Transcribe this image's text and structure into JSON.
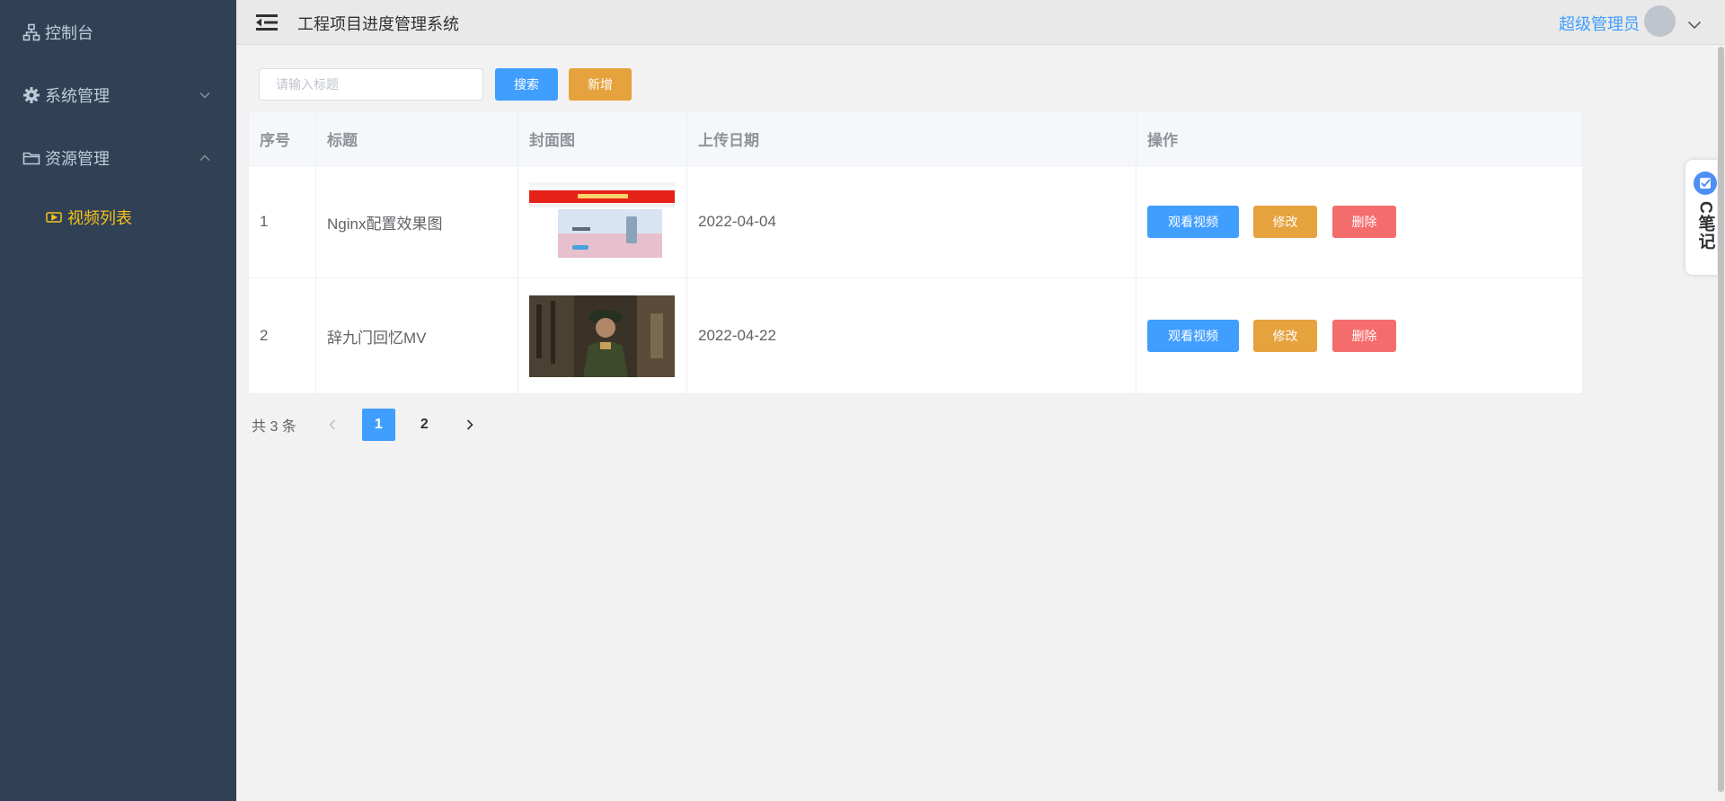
{
  "sidebar": {
    "items": [
      {
        "label": "控制台",
        "icon": "sitemap-icon"
      },
      {
        "label": "系统管理",
        "icon": "gear-icon",
        "expanded": false
      },
      {
        "label": "资源管理",
        "icon": "folder-icon",
        "expanded": true
      },
      {
        "label": "视频列表",
        "icon": "video-icon",
        "active": true
      }
    ],
    "active_color": "#f4c01a"
  },
  "header": {
    "title": "工程项目进度管理系统",
    "user_name": "超级管理员"
  },
  "toolbar": {
    "search_placeholder": "请输入标题",
    "search_value": "",
    "search_label": "搜索",
    "add_label": "新增"
  },
  "table": {
    "columns": [
      "序号",
      "标题",
      "封面图",
      "上传日期",
      "操作"
    ],
    "rows": [
      {
        "index": "1",
        "title": "Nginx配置效果图",
        "date": "2022-04-04"
      },
      {
        "index": "2",
        "title": "辞九门回忆MV",
        "date": "2022-04-22"
      }
    ],
    "actions": {
      "watch": "观看视频",
      "edit": "修改",
      "delete": "删除"
    }
  },
  "pagination": {
    "total_text": "共 3 条",
    "pages": [
      "1",
      "2"
    ],
    "current": "1"
  },
  "float_widget": {
    "text": "C笔记"
  },
  "colors": {
    "sidebar_bg": "#304156",
    "primary": "#409eff",
    "warning": "#e6a23c",
    "danger": "#f56c6c"
  }
}
